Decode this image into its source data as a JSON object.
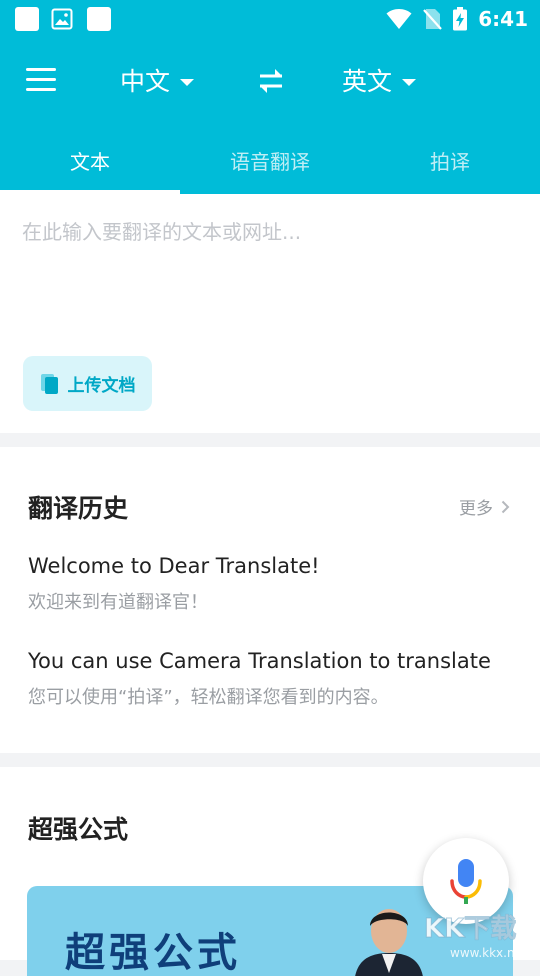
{
  "status_bar": {
    "time": "6:41"
  },
  "header": {
    "source_language": "中文",
    "target_language": "英文"
  },
  "tabs": [
    {
      "label": "文本",
      "active": true
    },
    {
      "label": "语音翻译",
      "active": false
    },
    {
      "label": "拍译",
      "active": false
    }
  ],
  "input": {
    "placeholder": "在此输入要翻译的文本或网址...",
    "value": "",
    "upload_label": "上传文档"
  },
  "history": {
    "title": "翻译历史",
    "more_label": "更多",
    "items": [
      {
        "source": "Welcome to Dear Translate!",
        "translation": "欢迎来到有道翻译官！"
      },
      {
        "source": "You can use Camera Translation to translate",
        "translation": "您可以使用“拍译”，轻松翻译您看到的内容。"
      }
    ]
  },
  "formula": {
    "title": "超强公式",
    "banner_text": "超强公式"
  },
  "colors": {
    "primary": "#00bcd8",
    "accent_text": "#00a8c6",
    "upload_bg": "#d9f5fa",
    "muted_text": "#9a9ea3"
  },
  "icons": {
    "menu": "hamburger-icon",
    "swap": "swap-arrows-icon",
    "upload": "document-icon",
    "more": "chevron-right-icon",
    "mic": "microphone-icon"
  }
}
